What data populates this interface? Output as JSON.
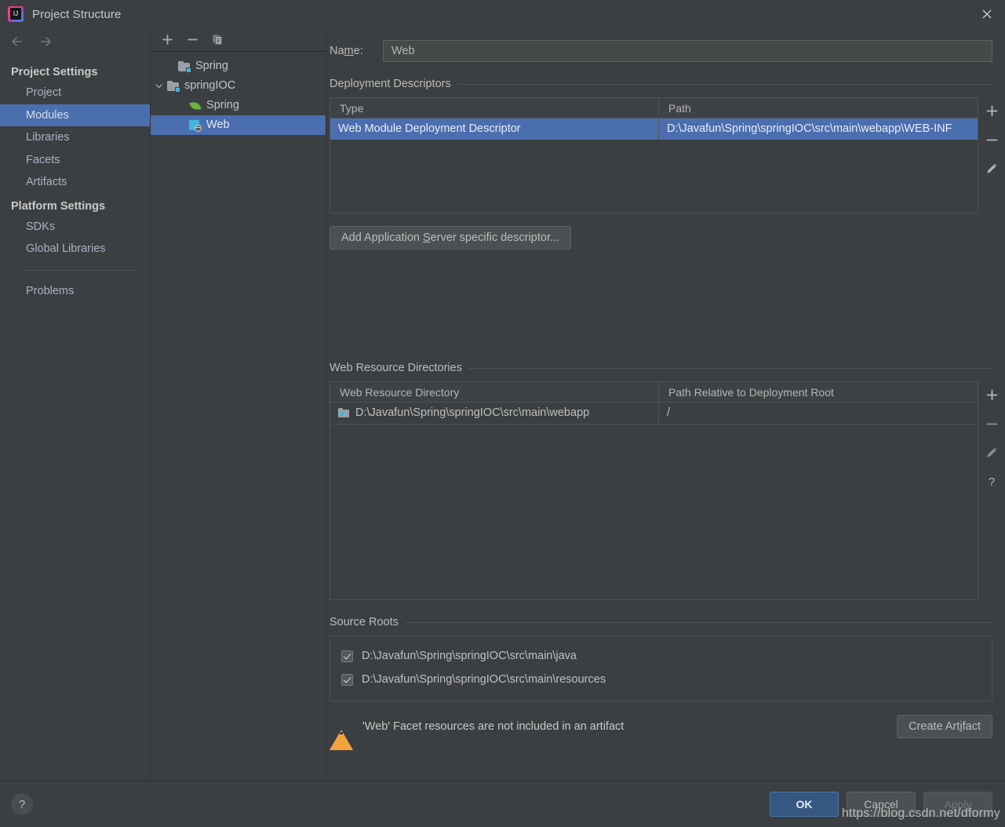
{
  "window": {
    "title": "Project Structure",
    "close_label": "✕"
  },
  "sidebar": {
    "back_icon": "arrow-left-icon",
    "forward_icon": "arrow-right-icon",
    "groups": [
      {
        "label": "Project Settings",
        "items": [
          {
            "label": "Project",
            "selected": false
          },
          {
            "label": "Modules",
            "selected": true
          },
          {
            "label": "Libraries",
            "selected": false
          },
          {
            "label": "Facets",
            "selected": false
          },
          {
            "label": "Artifacts",
            "selected": false
          }
        ]
      },
      {
        "label": "Platform Settings",
        "items": [
          {
            "label": "SDKs",
            "selected": false
          },
          {
            "label": "Global Libraries",
            "selected": false
          }
        ]
      }
    ],
    "problems_label": "Problems"
  },
  "module_tree": {
    "toolbar": {
      "add_label": "+",
      "remove_label": "−",
      "copy_label": "copy-icon"
    },
    "nodes": [
      {
        "label": "Spring",
        "icon": "module-icon",
        "indent": 1,
        "twisty": "",
        "selected": false
      },
      {
        "label": "springIOC",
        "icon": "module-icon",
        "indent": 0,
        "twisty": "expanded",
        "selected": false
      },
      {
        "label": "Spring",
        "icon": "spring-leaf-icon",
        "indent": 2,
        "twisty": "",
        "selected": false
      },
      {
        "label": "Web",
        "icon": "web-facet-icon",
        "indent": 2,
        "twisty": "",
        "selected": true
      }
    ]
  },
  "main": {
    "name_label_pre": "Na",
    "name_label_mnemonic": "m",
    "name_label_post": "e:",
    "name_value": "Web",
    "deployment": {
      "section_title": "Deployment Descriptors",
      "columns": [
        "Type",
        "Path"
      ],
      "rows": [
        {
          "type": "Web Module Deployment Descriptor",
          "path": "D:\\Javafun\\Spring\\springIOC\\src\\main\\webapp\\WEB-INF",
          "selected": true
        }
      ],
      "actions": [
        "add-icon",
        "remove-icon",
        "edit-icon"
      ]
    },
    "add_server_btn_pre": "Add Application ",
    "add_server_btn_mnemonic": "S",
    "add_server_btn_post": "erver specific descriptor...",
    "web_resources": {
      "section_title": "Web Resource Directories",
      "columns": [
        "Web Resource Directory",
        "Path Relative to Deployment Root"
      ],
      "rows": [
        {
          "directory": "D:\\Javafun\\Spring\\springIOC\\src\\main\\webapp",
          "relative_path": "/"
        }
      ],
      "actions": [
        "add-icon",
        "remove-icon",
        "edit-icon",
        "help-icon"
      ]
    },
    "source_roots": {
      "section_title": "Source Roots",
      "items": [
        {
          "path": "D:\\Javafun\\Spring\\springIOC\\src\\main\\java",
          "checked": true
        },
        {
          "path": "D:\\Javafun\\Spring\\springIOC\\src\\main\\resources",
          "checked": true
        }
      ]
    },
    "warning": {
      "icon": "warning-triangle-icon",
      "text": "'Web' Facet resources are not included in an artifact",
      "button_pre": "Create Art",
      "button_mnemonic": "i",
      "button_post": "fact"
    }
  },
  "footer": {
    "help_label": "?",
    "ok_label": "OK",
    "cancel_label": "Cancel",
    "apply_label": "Apply"
  },
  "watermark": "https://blog.csdn.net/dformy",
  "colors": {
    "background": "#3c3f41",
    "selection": "#4b6eaf",
    "primary_button": "#365880",
    "warning": "#f2a33c",
    "facet_blue": "#40b6e0",
    "spring_green": "#6cb33f",
    "text": "#bbbbbb"
  }
}
